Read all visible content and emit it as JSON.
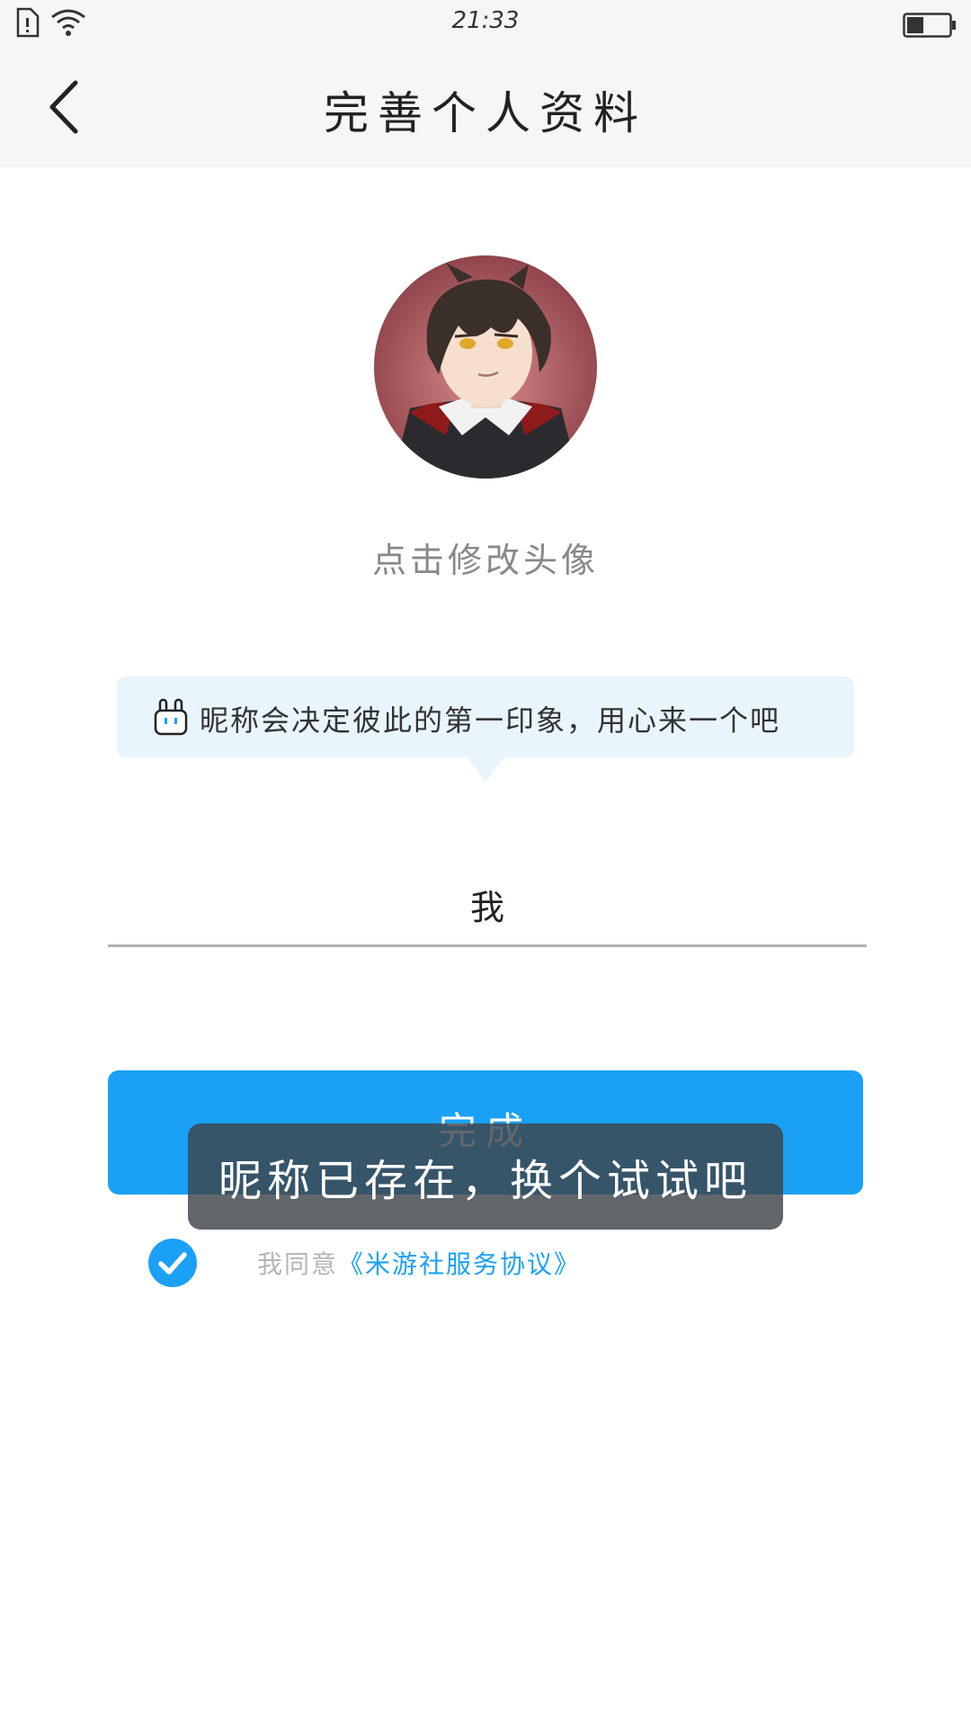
{
  "status_bar": {
    "time": "21:33",
    "icons": [
      "sim-alert-icon",
      "wifi-icon",
      "battery-icon"
    ]
  },
  "header": {
    "title": "完善个人资料",
    "back_icon": "chevron-left-icon"
  },
  "avatar": {
    "caption": "点击修改头像"
  },
  "tip": {
    "icon": "mascot-icon",
    "text": "昵称会决定彼此的第一印象，用心来一个吧"
  },
  "nickname": {
    "value": "我"
  },
  "done_button": {
    "label": "完成"
  },
  "toast": {
    "text": "昵称已存在，换个试试吧"
  },
  "agreement": {
    "checked": true,
    "prefix": "我同意",
    "link": "《米游社服务协议》"
  },
  "colors": {
    "accent": "#1aa1f5",
    "tip_bg": "#e9f5fd",
    "header_bg": "#f6f6f6",
    "toast_bg": "#3e444a"
  }
}
